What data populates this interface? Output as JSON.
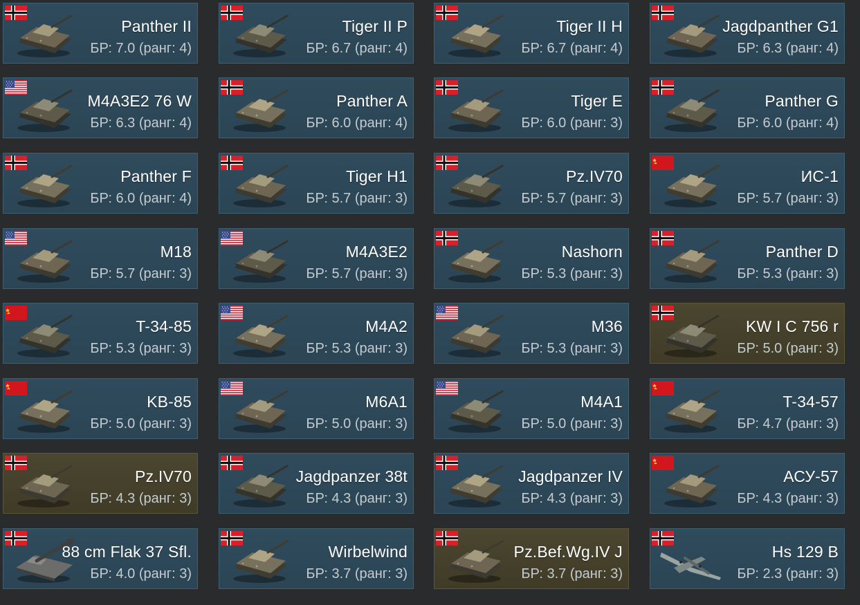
{
  "vehicles": [
    {
      "name": "Panther II",
      "br": "БР: 7.0 (ранг: 4)",
      "nation": "germany",
      "kind": "tank",
      "premium": false
    },
    {
      "name": "Tiger II P",
      "br": "БР: 6.7 (ранг: 4)",
      "nation": "germany",
      "kind": "tank",
      "premium": false
    },
    {
      "name": "Tiger II H",
      "br": "БР: 6.7 (ранг: 4)",
      "nation": "germany",
      "kind": "tank",
      "premium": false
    },
    {
      "name": "Jagdpanther G1",
      "br": "БР: 6.3 (ранг: 4)",
      "nation": "germany",
      "kind": "tank",
      "premium": false
    },
    {
      "name": "M4A3E2 76 W",
      "br": "БР: 6.3 (ранг: 4)",
      "nation": "usa",
      "kind": "tank",
      "premium": false
    },
    {
      "name": "Panther A",
      "br": "БР: 6.0 (ранг: 4)",
      "nation": "germany",
      "kind": "tank",
      "premium": false
    },
    {
      "name": "Tiger E",
      "br": "БР: 6.0 (ранг: 3)",
      "nation": "germany",
      "kind": "tank",
      "premium": false
    },
    {
      "name": "Panther G",
      "br": "БР: 6.0 (ранг: 4)",
      "nation": "germany",
      "kind": "tank",
      "premium": false
    },
    {
      "name": "Panther F",
      "br": "БР: 6.0 (ранг: 4)",
      "nation": "germany",
      "kind": "tank",
      "premium": false
    },
    {
      "name": "Tiger H1",
      "br": "БР: 5.7 (ранг: 3)",
      "nation": "germany",
      "kind": "tank",
      "premium": false
    },
    {
      "name": "Pz.IV70",
      "br": "БР: 5.7 (ранг: 3)",
      "nation": "germany",
      "kind": "tank",
      "premium": false
    },
    {
      "name": "ИС-1",
      "br": "БР: 5.7 (ранг: 3)",
      "nation": "ussr",
      "kind": "tank",
      "premium": false
    },
    {
      "name": "M18",
      "br": "БР: 5.7 (ранг: 3)",
      "nation": "usa",
      "kind": "tank",
      "premium": false
    },
    {
      "name": "M4A3E2",
      "br": "БР: 5.7 (ранг: 3)",
      "nation": "usa",
      "kind": "tank",
      "premium": false
    },
    {
      "name": "Nashorn",
      "br": "БР: 5.3 (ранг: 3)",
      "nation": "germany",
      "kind": "tank",
      "premium": false
    },
    {
      "name": "Panther D",
      "br": "БР: 5.3 (ранг: 3)",
      "nation": "germany",
      "kind": "tank",
      "premium": false
    },
    {
      "name": "T-34-85",
      "br": "БР: 5.3 (ранг: 3)",
      "nation": "ussr",
      "kind": "tank",
      "premium": false
    },
    {
      "name": "M4A2",
      "br": "БР: 5.3 (ранг: 3)",
      "nation": "usa",
      "kind": "tank",
      "premium": false
    },
    {
      "name": "M36",
      "br": "БР: 5.3 (ранг: 3)",
      "nation": "usa",
      "kind": "tank",
      "premium": false
    },
    {
      "name": "KW I C 756 r",
      "br": "БР: 5.0 (ранг: 3)",
      "nation": "germany",
      "kind": "tank",
      "premium": true
    },
    {
      "name": "KB-85",
      "br": "БР: 5.0 (ранг: 3)",
      "nation": "ussr",
      "kind": "tank",
      "premium": false
    },
    {
      "name": "M6A1",
      "br": "БР: 5.0 (ранг: 3)",
      "nation": "usa",
      "kind": "tank",
      "premium": false
    },
    {
      "name": "M4A1",
      "br": "БР: 5.0 (ранг: 3)",
      "nation": "usa",
      "kind": "tank",
      "premium": false
    },
    {
      "name": "T-34-57",
      "br": "БР: 4.7 (ранг: 3)",
      "nation": "ussr",
      "kind": "tank",
      "premium": false
    },
    {
      "name": "Pz.IV70",
      "br": "БР: 4.3 (ранг: 3)",
      "nation": "germany",
      "kind": "tank",
      "premium": true
    },
    {
      "name": "Jagdpanzer 38t",
      "br": "БР: 4.3 (ранг: 3)",
      "nation": "germany",
      "kind": "tank",
      "premium": false
    },
    {
      "name": "Jagdpanzer IV",
      "br": "БР: 4.3 (ранг: 3)",
      "nation": "germany",
      "kind": "tank",
      "premium": false
    },
    {
      "name": "АСУ-57",
      "br": "БР: 4.3 (ранг: 3)",
      "nation": "ussr",
      "kind": "tank",
      "premium": false
    },
    {
      "name": "88 cm Flak 37 Sfl.",
      "br": "БР: 4.0 (ранг: 3)",
      "nation": "germany",
      "kind": "tank",
      "premium": false
    },
    {
      "name": "Wirbelwind",
      "br": "БР: 3.7 (ранг: 3)",
      "nation": "germany",
      "kind": "tank",
      "premium": false
    },
    {
      "name": "Pz.Bef.Wg.IV J",
      "br": "БР: 3.7 (ранг: 3)",
      "nation": "germany",
      "kind": "tank",
      "premium": true
    },
    {
      "name": "Hs 129 B",
      "br": "БР: 2.3 (ранг: 3)",
      "nation": "germany",
      "kind": "aircraft",
      "premium": false
    }
  ],
  "colors": {
    "card": "#2f4b5c",
    "card_premium": "#4a4630",
    "background": "#2a2b2d",
    "name_text": "#ffffff",
    "br_text": "#c5ccd1"
  }
}
